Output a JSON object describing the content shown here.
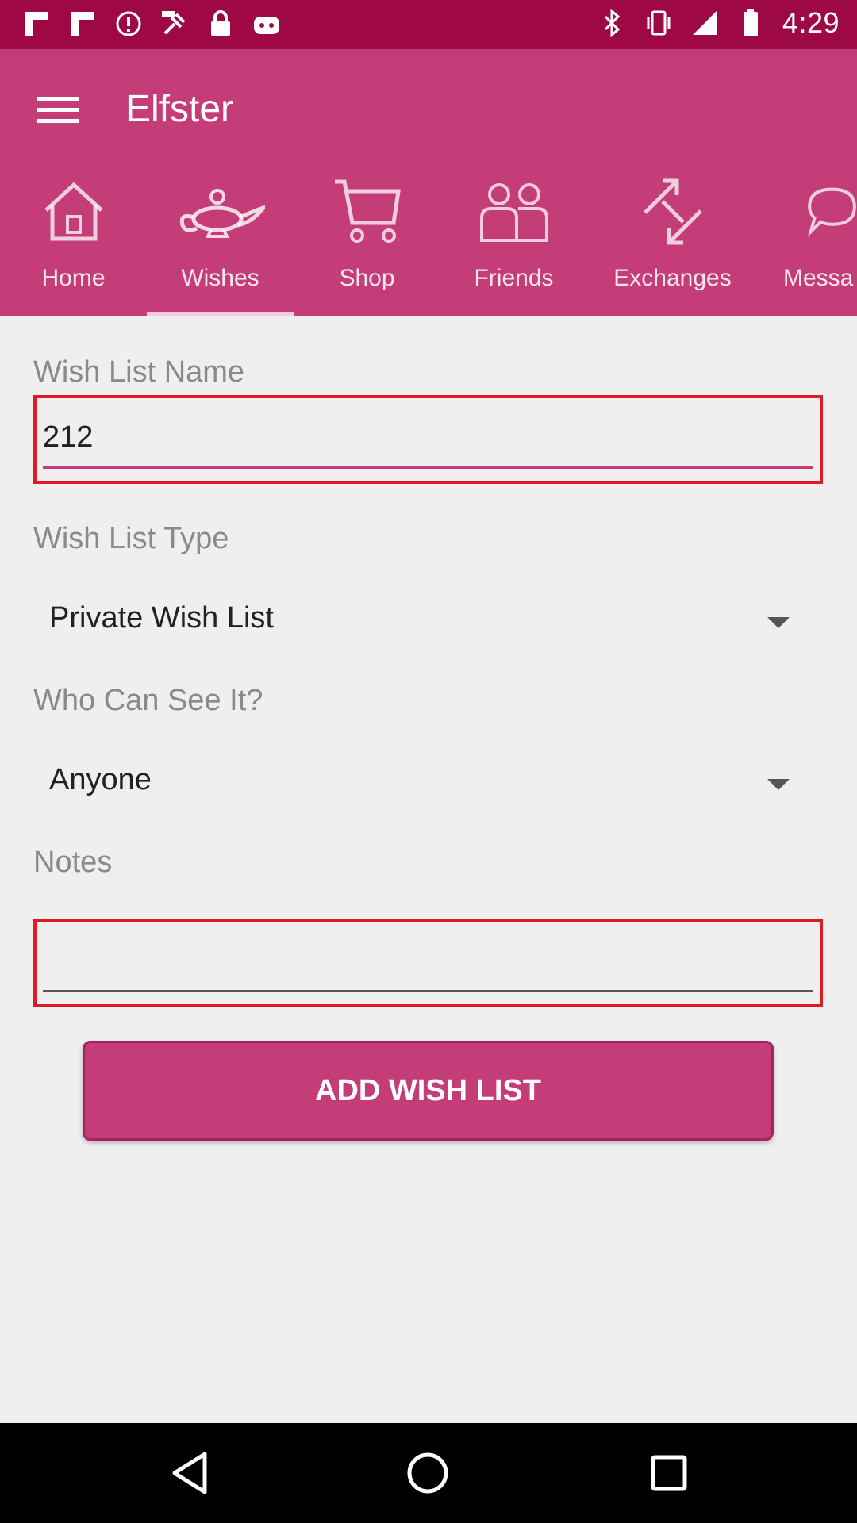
{
  "status_bar": {
    "time": "4:29",
    "left_icons": [
      "flipboard-icon",
      "flipboard-icon",
      "alert-icon",
      "fake-gps-icon",
      "lock-icon",
      "android-icon"
    ],
    "right_icons": [
      "bluetooth-icon",
      "vibrate-icon",
      "signal-icon",
      "battery-icon"
    ]
  },
  "app_bar": {
    "title": "Elfster",
    "color": "#c43c78",
    "tabs": [
      {
        "label": "Home",
        "icon": "home-icon"
      },
      {
        "label": "Wishes",
        "icon": "lamp-icon",
        "selected": true
      },
      {
        "label": "Shop",
        "icon": "cart-icon"
      },
      {
        "label": "Friends",
        "icon": "friends-icon"
      },
      {
        "label": "Exchanges",
        "icon": "exchange-icon"
      },
      {
        "label": "Messa",
        "icon": "message-icon"
      }
    ]
  },
  "form": {
    "name_label": "Wish List Name",
    "name_value": "212",
    "type_label": "Wish List Type",
    "type_value": "Private Wish List",
    "visibility_label": "Who Can See It?",
    "visibility_value": "Anyone",
    "notes_label": "Notes",
    "notes_value": ""
  },
  "actions": {
    "add_label": "ADD WISH LIST"
  },
  "nav_bar": {
    "buttons": [
      "back-icon",
      "home-icon",
      "recents-icon"
    ]
  }
}
